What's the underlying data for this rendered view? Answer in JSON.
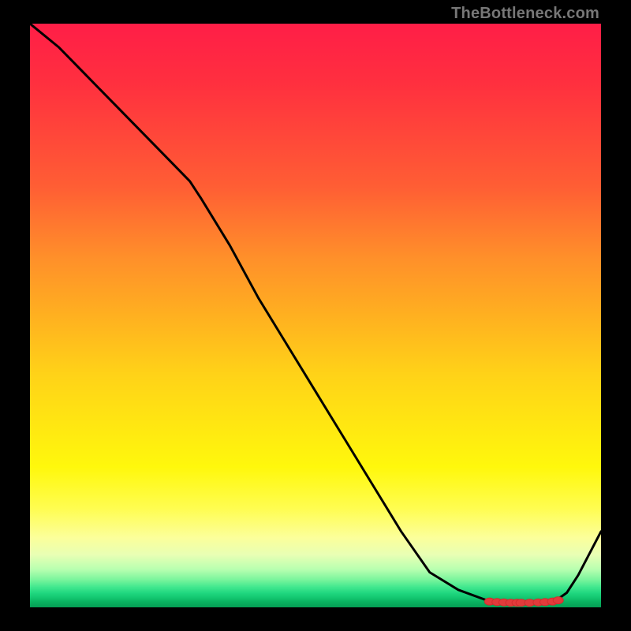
{
  "watermark": "TheBottleneck.com",
  "colors": {
    "frame": "#000000",
    "curve": "#000000",
    "marker": "#e23b3b"
  },
  "chart_data": {
    "type": "line",
    "title": "",
    "xlabel": "",
    "ylabel": "",
    "xlim": [
      0,
      100
    ],
    "ylim": [
      0,
      100
    ],
    "x": [
      0,
      5,
      10,
      15,
      20,
      24,
      28,
      30,
      35,
      40,
      45,
      50,
      55,
      60,
      65,
      70,
      75,
      80,
      82,
      84,
      86,
      88,
      90,
      92,
      94,
      96,
      100
    ],
    "y": [
      100,
      96,
      91,
      86,
      81,
      77,
      73,
      70,
      62,
      53,
      45,
      37,
      29,
      21,
      13,
      6,
      3,
      1.2,
      0.9,
      0.8,
      0.8,
      0.8,
      0.9,
      1.1,
      2.5,
      5.5,
      13
    ],
    "markers": {
      "note": "dots near valley along x≈80–92 where curve is at minimum",
      "x": [
        80.5,
        81.8,
        83.0,
        84.2,
        85.3,
        86.0,
        87.5,
        89.0,
        90.2,
        91.5,
        92.5
      ],
      "y": [
        1.0,
        0.9,
        0.85,
        0.8,
        0.8,
        0.8,
        0.8,
        0.85,
        0.9,
        1.0,
        1.2
      ]
    },
    "background_gradient_stops": [
      {
        "pct": 0,
        "color": "#ff1e47"
      },
      {
        "pct": 50,
        "color": "#ffb020"
      },
      {
        "pct": 80,
        "color": "#fffd50"
      },
      {
        "pct": 96,
        "color": "#42e88f"
      },
      {
        "pct": 100,
        "color": "#059e54"
      }
    ]
  }
}
